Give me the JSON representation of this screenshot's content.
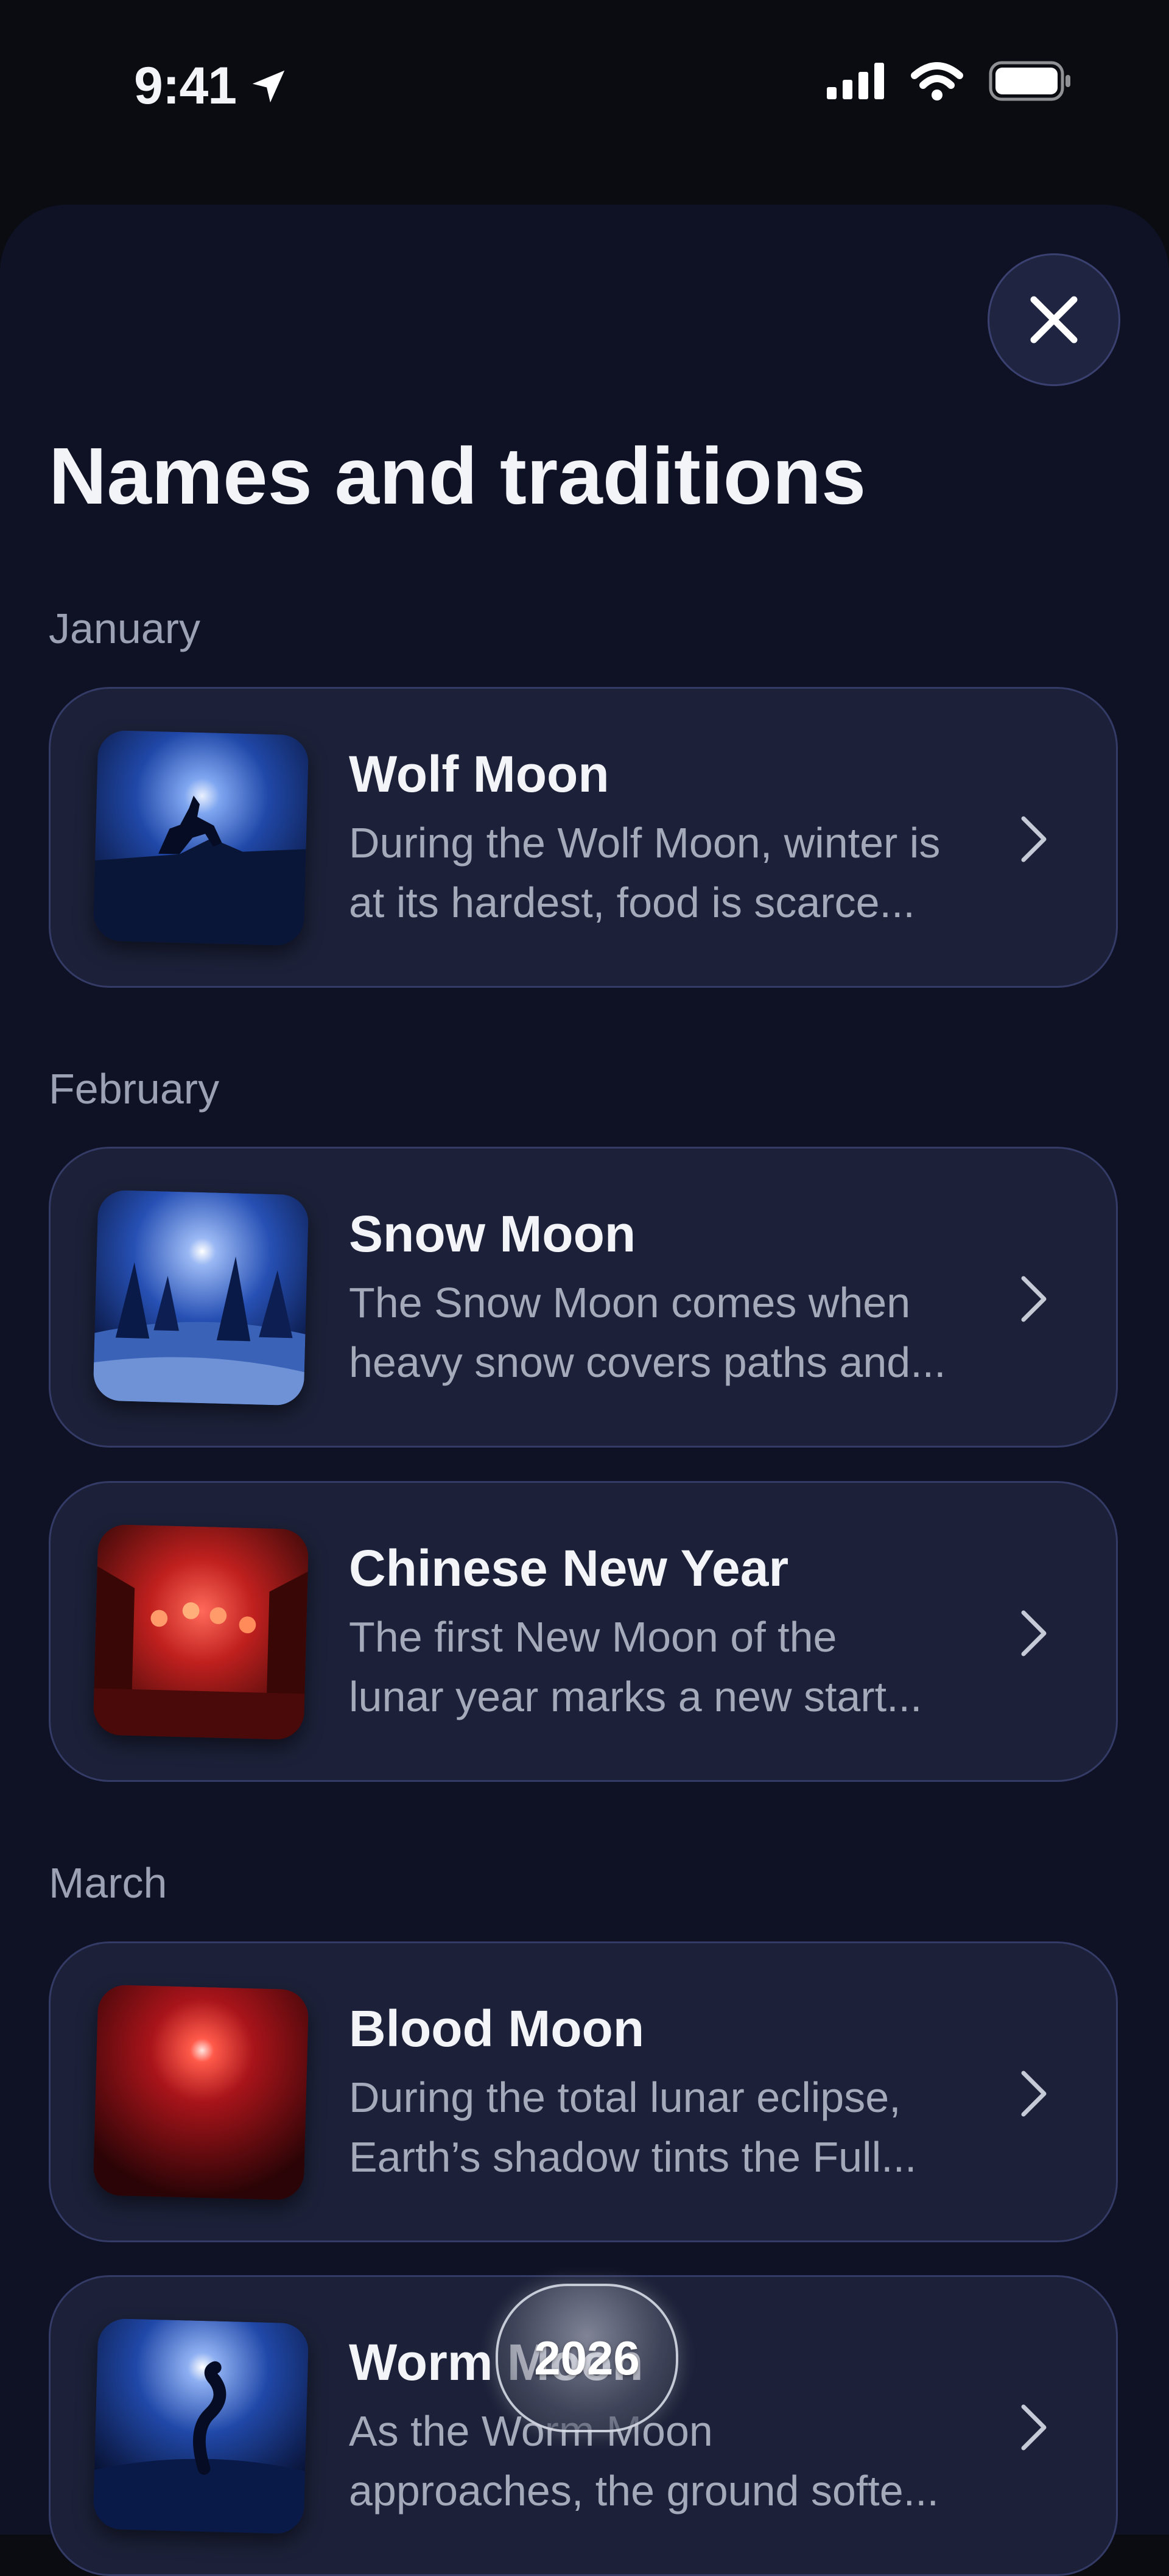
{
  "status_bar": {
    "time": "9:41",
    "icons": [
      "location-arrow-icon",
      "cellular-signal-icon",
      "wifi-icon",
      "battery-icon"
    ]
  },
  "sheet": {
    "title": "Names and traditions",
    "close_icon": "close-icon"
  },
  "sections": [
    {
      "label": "January"
    },
    {
      "label": "February"
    },
    {
      "label": "March"
    }
  ],
  "cards": [
    {
      "title": "Wolf Moon",
      "description": "During the Wolf Moon, winter is\nat its hardest, food is scarce...",
      "image": "wolf-moon-image"
    },
    {
      "title": "Snow Moon",
      "description": "The Snow Moon comes when\nheavy snow covers paths and...",
      "image": "snow-moon-image"
    },
    {
      "title": "Chinese New Year",
      "description": "The first New Moon of the\nlunar year marks a new start...",
      "image": "chinese-new-year-image"
    },
    {
      "title": "Blood Moon",
      "description": "During the total lunar eclipse,\nEarth’s shadow tints the Full...",
      "image": "blood-moon-image"
    },
    {
      "title": "Worm Moon",
      "description": "As the Worm Moon\napproaches, the ground softe...",
      "image": "worm-moon-image"
    }
  ],
  "year_selector": {
    "label": "2026"
  },
  "colors": {
    "background": "#0a0c12",
    "sheet": "#0e1224",
    "card": "#1c2139",
    "card_border": "#343b66",
    "muted_text": "#a5aabb"
  }
}
